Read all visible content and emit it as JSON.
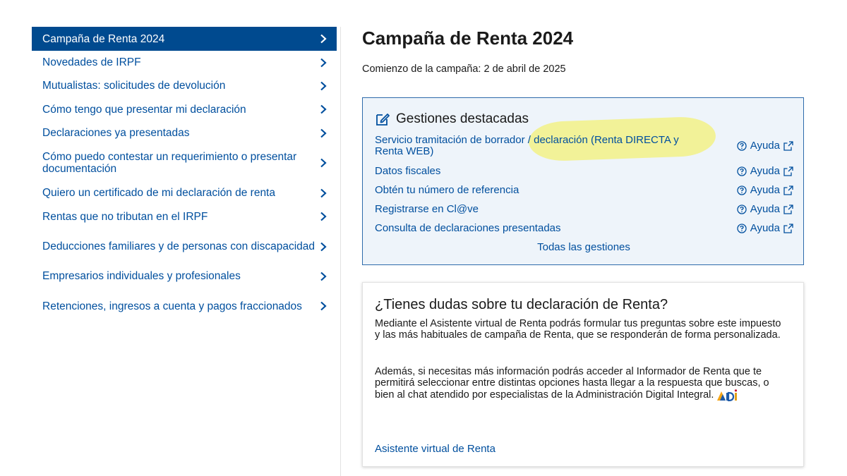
{
  "sidebar": {
    "items": [
      {
        "label": "Campaña de Renta 2024"
      },
      {
        "label": "Novedades de IRPF"
      },
      {
        "label": "Mutualistas: solicitudes de devolución"
      },
      {
        "label": "Cómo tengo que presentar mi declaración"
      },
      {
        "label": "Declaraciones ya presentadas"
      },
      {
        "label": "Cómo puedo contestar un requerimiento o presentar documentación"
      },
      {
        "label": "Quiero un certificado de mi declaración de renta"
      },
      {
        "label": "Rentas que no tributan en el IRPF"
      },
      {
        "label": "Deducciones familiares y de personas con discapacidad"
      },
      {
        "label": "Empresarios individuales y profesionales"
      },
      {
        "label": "Retenciones, ingresos a cuenta y pagos fraccionados"
      }
    ]
  },
  "main": {
    "title": "Campaña de Renta 2024",
    "campaign_start": "Comienzo de la campaña: 2 de abril de 2025"
  },
  "gestiones": {
    "heading": "Gestiones destacadas",
    "help_label": "Ayuda",
    "items": [
      {
        "label": "Servicio tramitación de borrador / declaración (Renta DIRECTA y Renta WEB)"
      },
      {
        "label": "Datos fiscales"
      },
      {
        "label": "Obtén tu número de referencia"
      },
      {
        "label": "Registrarse en Cl@ve"
      },
      {
        "label": "Consulta de declaraciones presentadas"
      }
    ],
    "all_link": "Todas las gestiones"
  },
  "dudas": {
    "title": "¿Tienes dudas sobre tu declaración de Renta?",
    "p1": "Mediante el Asistente virtual de Renta podrás formular tus preguntas sobre este impuesto y las más habituales de campaña de Renta, que se responderán de forma personalizada.",
    "p2": "Además, si necesitas más información podrás acceder al Informador de Renta que te permitirá seleccionar entre distintas opciones hasta llegar a la respuesta que buscas, o bien al chat atendido por especialistas de la Administración Digital Integral.",
    "link": "Asistente virtual de Renta"
  },
  "colors": {
    "link": "#004f9e",
    "active_bg": "#004a8f",
    "panel_bg": "#eef4fa",
    "panel_border": "#2d6aab",
    "highlight": "#f6f147"
  },
  "icons": {
    "chevron": "chevron-right-icon",
    "edit": "edit-icon",
    "help": "question-circle-icon",
    "external": "external-link-icon"
  }
}
